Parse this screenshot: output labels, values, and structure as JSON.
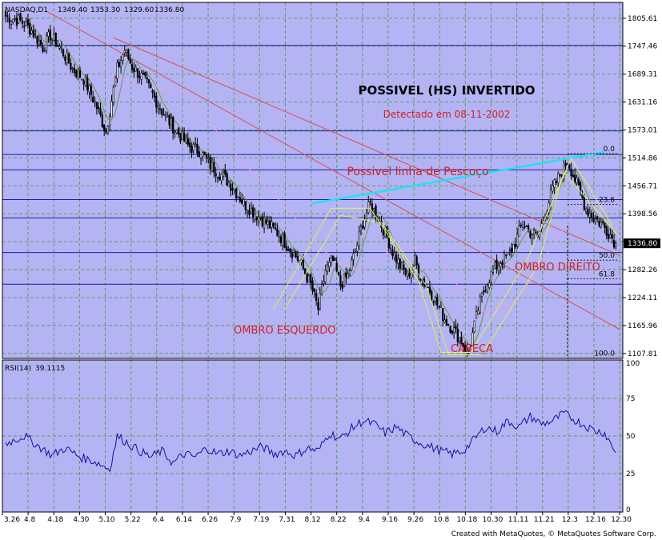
{
  "chart_data": {
    "type": "candlestick",
    "symbol_header": "NASDAQ,D1",
    "ohlc_header": [
      "1349.40",
      "1353.30",
      "1329.60",
      "1336.80"
    ],
    "title": "POSSIVEL (HS) INVERTIDO",
    "subtitle": "Detectado em 08-11-2002",
    "neckline_label": "Possivel linha de Pescoço",
    "pattern_labels": {
      "left_shoulder": "OMBRO ESQUERDO",
      "head": "CABEÇA",
      "right_shoulder": "OMBRO DIREITO"
    },
    "current_price_label": "1336.80",
    "colors": {
      "background": "#b4b4f5",
      "grid": "#5a9a5a",
      "hline": "#1a1a9a",
      "candle": "#000000",
      "ma_fast": "#6a9a3a",
      "ma_slow": "#e04a4a",
      "ma_long": "#e8a0e8",
      "trend_red": "#e04a4a",
      "neckline": "#22e0f0",
      "pattern_lines": "#e0f060",
      "rsi": "#1010a0",
      "label_red": "#d02020",
      "fib_dash": "#000000"
    },
    "y_axis": {
      "min": 1097.5,
      "max": 1838.5,
      "ticks": [
        "1805.61",
        "1747.46",
        "1689.31",
        "1631.16",
        "1573.01",
        "1514.86",
        "1456.71",
        "1398.56",
        "1340.41",
        "1282.26",
        "1224.11",
        "1165.96",
        "1107.81"
      ]
    },
    "horizontal_lines": [
      1749,
      1571,
      1522,
      1490,
      1428,
      1390,
      1318,
      1252
    ],
    "fibonacci": {
      "levels": [
        "0.0",
        "23.6",
        "50.0",
        "61.8",
        "100.0"
      ],
      "prices": [
        1524,
        1418,
        1302,
        1263,
        1098
      ],
      "dashed_from_price": 1374
    },
    "x_axis": {
      "tick_labels": [
        "3.26",
        "4.8",
        "4.18",
        "4.30",
        "5.10",
        "5.22",
        "6.4",
        "6.14",
        "6.26",
        "7.9",
        "7.19",
        "7.31",
        "8.12",
        "8.22",
        "9.4",
        "9.16",
        "9.26",
        "10.8",
        "10.18",
        "10.30",
        "11.11",
        "11.21",
        "12.3",
        "12.16",
        "12.30"
      ]
    },
    "close_anchors": [
      [
        0,
        1810
      ],
      [
        8,
        1800
      ],
      [
        14,
        1780
      ],
      [
        20,
        1745
      ],
      [
        24,
        1770
      ],
      [
        30,
        1740
      ],
      [
        36,
        1700
      ],
      [
        42,
        1680
      ],
      [
        48,
        1630
      ],
      [
        54,
        1570
      ],
      [
        60,
        1700
      ],
      [
        64,
        1740
      ],
      [
        68,
        1705
      ],
      [
        74,
        1680
      ],
      [
        80,
        1640
      ],
      [
        86,
        1600
      ],
      [
        92,
        1570
      ],
      [
        98,
        1540
      ],
      [
        104,
        1530
      ],
      [
        110,
        1500
      ],
      [
        116,
        1480
      ],
      [
        122,
        1455
      ],
      [
        128,
        1420
      ],
      [
        134,
        1400
      ],
      [
        140,
        1380
      ],
      [
        146,
        1360
      ],
      [
        152,
        1330
      ],
      [
        158,
        1300
      ],
      [
        164,
        1250
      ],
      [
        168,
        1200
      ],
      [
        172,
        1280
      ],
      [
        176,
        1300
      ],
      [
        180,
        1250
      ],
      [
        184,
        1270
      ],
      [
        188,
        1320
      ],
      [
        192,
        1380
      ],
      [
        196,
        1420
      ],
      [
        200,
        1390
      ],
      [
        204,
        1360
      ],
      [
        208,
        1320
      ],
      [
        212,
        1290
      ],
      [
        216,
        1270
      ],
      [
        220,
        1300
      ],
      [
        224,
        1260
      ],
      [
        228,
        1240
      ],
      [
        232,
        1210
      ],
      [
        236,
        1180
      ],
      [
        240,
        1160
      ],
      [
        244,
        1140
      ],
      [
        248,
        1110
      ],
      [
        250,
        1130
      ],
      [
        254,
        1200
      ],
      [
        258,
        1250
      ],
      [
        262,
        1280
      ],
      [
        266,
        1300
      ],
      [
        270,
        1310
      ],
      [
        274,
        1340
      ],
      [
        278,
        1380
      ],
      [
        282,
        1360
      ],
      [
        286,
        1350
      ],
      [
        290,
        1400
      ],
      [
        294,
        1450
      ],
      [
        298,
        1480
      ],
      [
        302,
        1510
      ],
      [
        304,
        1490
      ],
      [
        308,
        1450
      ],
      [
        312,
        1410
      ],
      [
        316,
        1390
      ],
      [
        320,
        1380
      ],
      [
        324,
        1360
      ],
      [
        328,
        1337
      ]
    ],
    "rsi": {
      "label": "RSI(14)",
      "value": "39.1115",
      "ticks": [
        "100",
        "75",
        "50",
        "25",
        "0"
      ],
      "anchors": [
        [
          0,
          45
        ],
        [
          10,
          50
        ],
        [
          18,
          43
        ],
        [
          25,
          37
        ],
        [
          32,
          42
        ],
        [
          40,
          36
        ],
        [
          48,
          33
        ],
        [
          56,
          28
        ],
        [
          60,
          50
        ],
        [
          66,
          45
        ],
        [
          72,
          40
        ],
        [
          78,
          36
        ],
        [
          84,
          40
        ],
        [
          90,
          32
        ],
        [
          96,
          38
        ],
        [
          102,
          36
        ],
        [
          108,
          42
        ],
        [
          114,
          38
        ],
        [
          120,
          40
        ],
        [
          126,
          37
        ],
        [
          132,
          40
        ],
        [
          138,
          43
        ],
        [
          144,
          38
        ],
        [
          150,
          40
        ],
        [
          156,
          37
        ],
        [
          162,
          42
        ],
        [
          168,
          40
        ],
        [
          174,
          52
        ],
        [
          180,
          48
        ],
        [
          186,
          55
        ],
        [
          192,
          60
        ],
        [
          198,
          58
        ],
        [
          204,
          52
        ],
        [
          210,
          56
        ],
        [
          216,
          50
        ],
        [
          222,
          46
        ],
        [
          228,
          43
        ],
        [
          234,
          40
        ],
        [
          240,
          38
        ],
        [
          246,
          40
        ],
        [
          252,
          48
        ],
        [
          258,
          56
        ],
        [
          264,
          53
        ],
        [
          270,
          60
        ],
        [
          276,
          56
        ],
        [
          282,
          63
        ],
        [
          288,
          58
        ],
        [
          294,
          60
        ],
        [
          300,
          65
        ],
        [
          304,
          62
        ],
        [
          310,
          58
        ],
        [
          316,
          54
        ],
        [
          322,
          52
        ],
        [
          328,
          39
        ]
      ]
    }
  },
  "footer": "Created with MetaQuotes, © MetaQuotes Software Corp."
}
